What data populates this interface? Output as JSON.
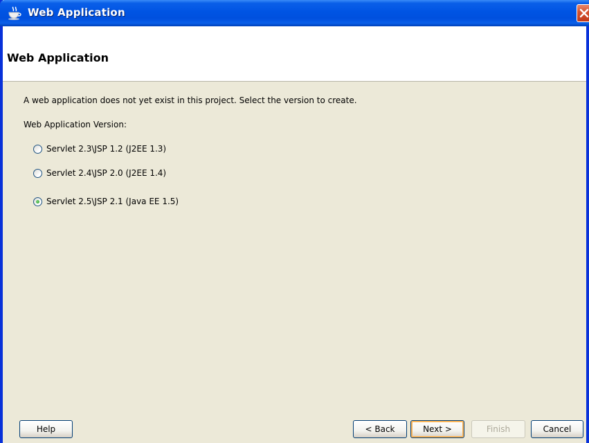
{
  "window": {
    "title": "Web Application",
    "icon": "coffee-cup-icon",
    "colors": {
      "titlebar": "#0054e3",
      "close": "#d6542f",
      "background": "#ece9d8"
    }
  },
  "header": {
    "title": "Web Application"
  },
  "content": {
    "description": "A web application does not yet exist in this project. Select the version to create.",
    "version_label": "Web Application Version:",
    "options": [
      {
        "label": "Servlet 2.3\\JSP 1.2 (J2EE 1.3)",
        "checked": false
      },
      {
        "label": "Servlet 2.4\\JSP 2.0 (J2EE 1.4)",
        "checked": false
      },
      {
        "label": "Servlet 2.5\\JSP 2.1 (Java EE 1.5)",
        "checked": true
      }
    ]
  },
  "buttons": {
    "help": "Help",
    "back": "< Back",
    "next": "Next >",
    "finish": "Finish",
    "cancel": "Cancel"
  }
}
